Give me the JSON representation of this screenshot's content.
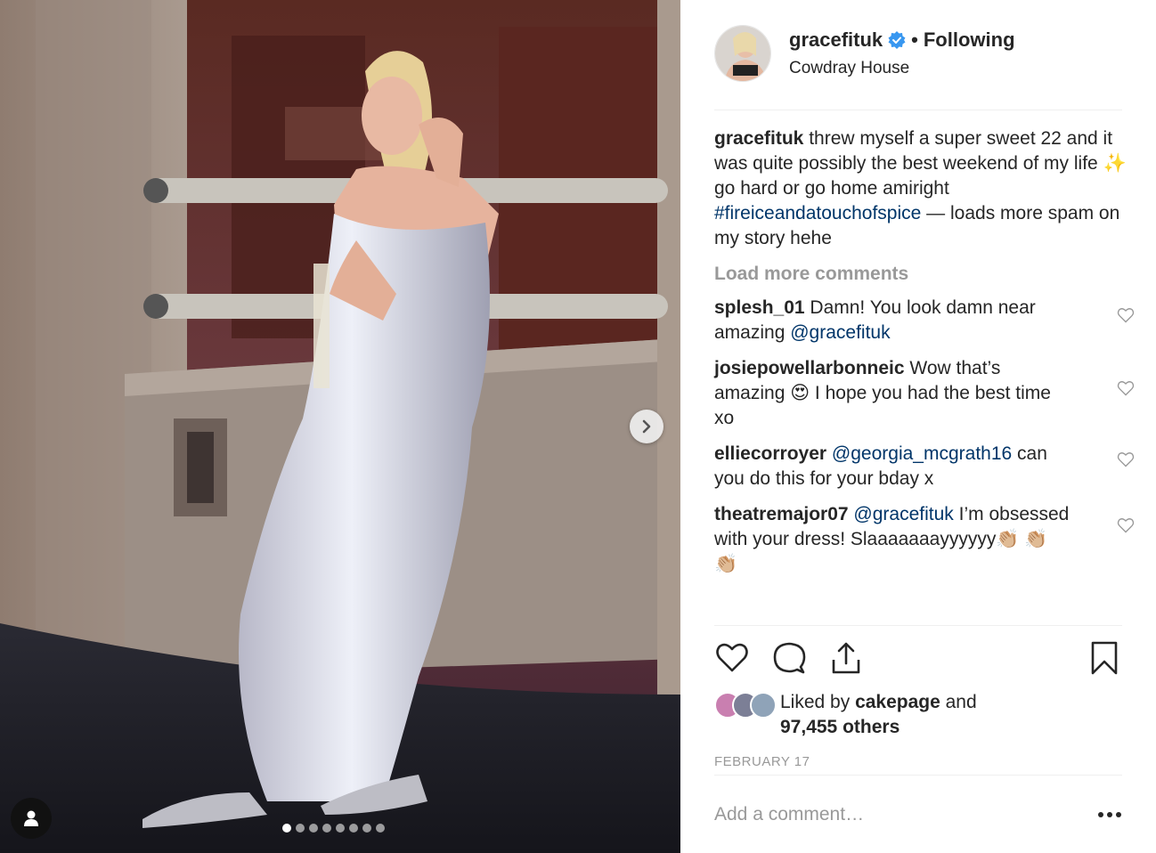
{
  "post": {
    "username": "gracefituk",
    "separator": "•",
    "follow_status": "Following",
    "location": "Cowdray House",
    "caption": {
      "username": "gracefituk",
      "text_part1": "threw myself a super sweet 22 and it was quite possibly the best weekend of my life ✨  go hard or go home amiright ",
      "hashtag": "#fireiceandatouchofspice",
      "text_part2": " — loads more spam on my story hehe"
    },
    "load_more_label": "Load more comments",
    "comments": [
      {
        "username": "splesh_01",
        "pre": " Damn! You look damn near amazing ",
        "mention": "@gracefituk",
        "post": ""
      },
      {
        "username": "josiepowellarbonneic",
        "pre": " Wow that’s amazing 😍  I hope you had the best time xo",
        "mention": "",
        "post": ""
      },
      {
        "username": "elliecorroyer",
        "pre": " ",
        "mention": "@georgia_mcgrath16",
        "post": " can you do this for your bday x"
      },
      {
        "username": "theatremajor07",
        "pre": " ",
        "mention": "@gracefituk",
        "post": " I’m obsessed with your dress! Slaaaaaaayyyyyy👏🏼 👏🏼 👏🏼"
      }
    ],
    "likes": {
      "prefix": "Liked by ",
      "first_liker": "cakepage",
      "middle": " and",
      "count": "97,455 others"
    },
    "date": "FEBRUARY 17",
    "add_comment_placeholder": "Add a comment…",
    "carousel": {
      "slides": 8,
      "active_index": 0
    },
    "colors": {
      "verified": "#3897f0",
      "link": "#003569",
      "muted": "#999999"
    },
    "icons": [
      "verified-icon",
      "chevron-right-icon",
      "user-tag-icon",
      "heart-icon",
      "comment-icon",
      "share-icon",
      "bookmark-icon",
      "more-icon"
    ]
  }
}
